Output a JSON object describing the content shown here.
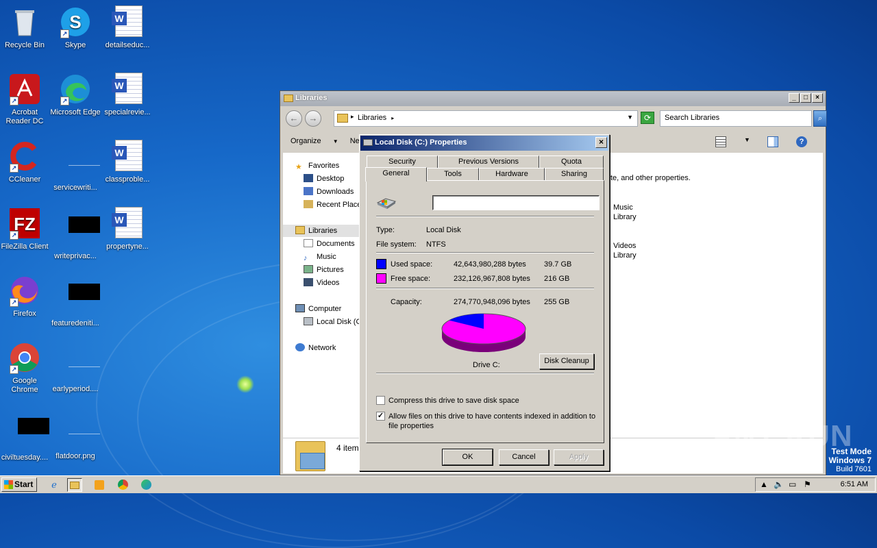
{
  "desktop": {
    "icons": [
      {
        "label": "Recycle Bin"
      },
      {
        "label": "Skype"
      },
      {
        "label": "detailseduc..."
      },
      {
        "label": "Acrobat Reader DC"
      },
      {
        "label": "Microsoft Edge"
      },
      {
        "label": "specialrevie..."
      },
      {
        "label": "CCleaner"
      },
      {
        "label": "servicewriti..."
      },
      {
        "label": "classproble..."
      },
      {
        "label": "FileZilla Client"
      },
      {
        "label": "writeprivac..."
      },
      {
        "label": "propertyne..."
      },
      {
        "label": "Firefox"
      },
      {
        "label": "featuredeniti..."
      },
      {
        "label": "Google Chrome"
      },
      {
        "label": "earlyperiod...."
      },
      {
        "label": "civiltuesday...."
      },
      {
        "label": "flatdoor.png"
      }
    ]
  },
  "explorer": {
    "title": "Libraries",
    "address": "Libraries",
    "search_placeholder": "Search Libraries",
    "toolbar": {
      "organize": "Organize",
      "new": "New"
    },
    "nav": {
      "favorites": "Favorites",
      "desktop": "Desktop",
      "downloads": "Downloads",
      "recent": "Recent Place",
      "libraries": "Libraries",
      "documents": "Documents",
      "music": "Music",
      "pictures": "Pictures",
      "videos": "Videos",
      "computer": "Computer",
      "localdisk": "Local Disk (C",
      "network": "Network"
    },
    "content": {
      "desc_fragment": "te, and other properties.",
      "music": "Music",
      "music_sub": "Library",
      "videos": "Videos",
      "videos_sub": "Library"
    },
    "details_count": "4 item"
  },
  "dialog": {
    "title": "Local Disk (C:) Properties",
    "tabs_row1": [
      "Security",
      "Previous Versions",
      "Quota"
    ],
    "tabs_row2": [
      "General",
      "Tools",
      "Hardware",
      "Sharing"
    ],
    "name_value": "",
    "type_label": "Type:",
    "type_value": "Local Disk",
    "fs_label": "File system:",
    "fs_value": "NTFS",
    "used_label": "Used space:",
    "used_bytes": "42,643,980,288 bytes",
    "used_gb": "39.7 GB",
    "free_label": "Free space:",
    "free_bytes": "232,126,967,808 bytes",
    "free_gb": "216 GB",
    "capacity_label": "Capacity:",
    "capacity_bytes": "274,770,948,096 bytes",
    "capacity_gb": "255 GB",
    "drive_label": "Drive C:",
    "disk_cleanup": "Disk Cleanup",
    "compress_label": "Compress this drive to save disk space",
    "compress_checked": false,
    "index_label": "Allow files on this drive to have contents indexed in addition to file properties",
    "index_checked": true,
    "ok": "OK",
    "cancel": "Cancel",
    "apply": "Apply",
    "used_fraction": 0.155,
    "colors": {
      "used": "#0000ff",
      "free": "#ff00ff"
    }
  },
  "taskbar": {
    "start": "Start",
    "clock": "6:51 AM"
  },
  "watermark": {
    "line1": "Test Mode",
    "line2": "Windows 7",
    "line3": "Build 7601",
    "brand": "ANY RUN"
  }
}
